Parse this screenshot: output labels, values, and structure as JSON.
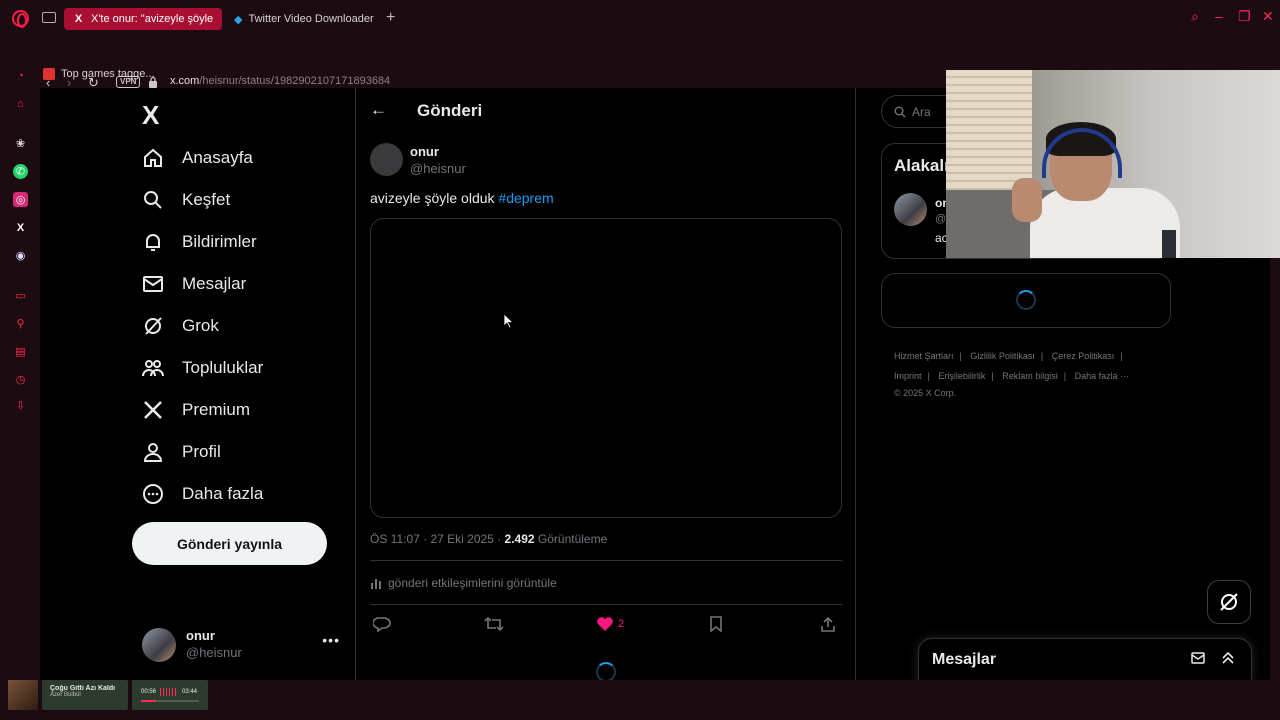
{
  "browser": {
    "tabs": [
      {
        "label": "X'te onur: \"avizeyle şöyle",
        "favicon": "x-logo-icon",
        "active": true
      },
      {
        "label": "Twitter Video Downloader",
        "favicon": "download-bird-icon",
        "active": false
      }
    ],
    "url_host": "x.com",
    "url_path": "/heisnur/status/1982902107171893684",
    "vpn_label": "VPN",
    "bookmark": "Top games tagge...",
    "accent_color": "#ff1b4c",
    "gx_label": "GX"
  },
  "nav": {
    "logo": "X",
    "items": [
      {
        "label": "Anasayfa",
        "icon": "home-icon",
        "glyph": "⌂"
      },
      {
        "label": "Keşfet",
        "icon": "search-icon",
        "glyph": "⌕"
      },
      {
        "label": "Bildirimler",
        "icon": "bell-icon",
        "glyph": "🔔"
      },
      {
        "label": "Mesajlar",
        "icon": "envelope-icon",
        "glyph": "✉"
      },
      {
        "label": "Grok",
        "icon": "grok-icon",
        "glyph": "⊘"
      },
      {
        "label": "Topluluklar",
        "icon": "communities-icon",
        "glyph": "👥"
      },
      {
        "label": "Premium",
        "icon": "x-premium-icon",
        "glyph": "𝕏"
      },
      {
        "label": "Profil",
        "icon": "person-icon",
        "glyph": "👤"
      },
      {
        "label": "Daha fazla",
        "icon": "more-circle-icon",
        "glyph": "⋯"
      }
    ],
    "post_button": "Gönderi yayınla",
    "account_name": "onur",
    "account_handle": "@heisnur"
  },
  "main": {
    "title": "Gönderi",
    "author_name": "onur",
    "author_handle": "@heisnur",
    "text": "avizeyle şöyle olduk",
    "hashtag": "#deprem",
    "timestamp": "ÖS 11:07 · 27 Eki 2025 ·",
    "views_count": "2.492",
    "views_label": "Görüntüleme",
    "engagements_link": "gönderi etkileşimlerini görüntüle",
    "likes": "2"
  },
  "right": {
    "search_placeholder": "Ara",
    "related_title": "Alakalı",
    "related_name": "on",
    "related_handle": "@",
    "related_bio": "ac",
    "footer": [
      "Hizmet Şartları",
      "|",
      "Gizlilik Politikası",
      "|",
      "Çerez Politikası",
      "|",
      "Imprint",
      "|",
      "Erişilebilirlik",
      "|",
      "Reklam bilgisi",
      "|",
      "Daha fazla ···",
      "© 2025 X Corp."
    ],
    "messages_title": "Mesajlar"
  },
  "media_player": {
    "song": "Çoğu Gitti Azı Kaldı",
    "artist": "Azer Bülbül",
    "current_time": "00:56",
    "total_time": "03:44",
    "progress": 0.25
  }
}
